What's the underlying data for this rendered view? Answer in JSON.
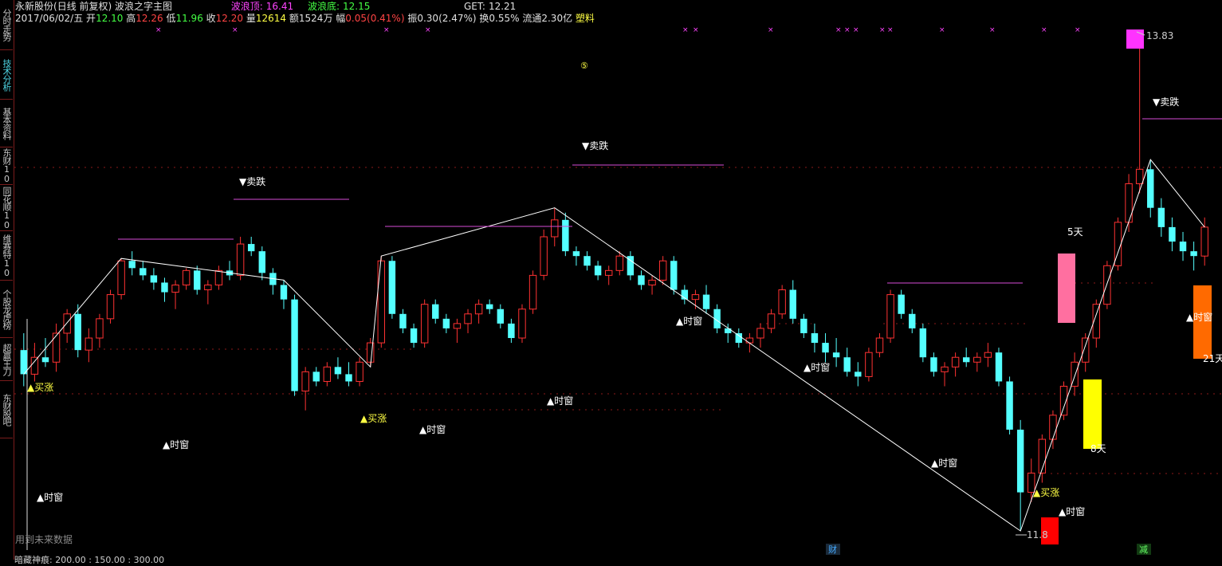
{
  "sidebar": {
    "tabs": [
      {
        "label": "分时走势",
        "active": false
      },
      {
        "label": "技术分析",
        "active": true
      },
      {
        "label": "基本资料",
        "active": false
      },
      {
        "label": "东财10",
        "active": false
      },
      {
        "label": "同花顺10",
        "active": false
      },
      {
        "label": "维赛特10",
        "active": false
      },
      {
        "label": "个股龙虎榜",
        "active": false
      },
      {
        "label": "超赢王刀",
        "active": false
      },
      {
        "label": "东财股吧",
        "active": false
      }
    ]
  },
  "header": {
    "stock_name": "永新股份",
    "period": "(日线 前复权)",
    "indicator_name": "波浪之字主图",
    "wave_top_label": "波浪顶:",
    "wave_top_value": "16.41",
    "wave_bottom_label": "波浪底:",
    "wave_bottom_value": "12.15",
    "get_label": "GET:",
    "get_value": "12.21",
    "date": "2017/06/02/五",
    "open_label": "开",
    "open": "12.10",
    "high_label": "高",
    "high": "12.26",
    "low_label": "低",
    "low": "11.96",
    "close_label": "收",
    "close": "12.20",
    "volume_label": "量",
    "volume": "12614",
    "amount_label": "额",
    "amount": "1524万",
    "change_label": "幅",
    "change": "0.05(0.41%)",
    "amplitude_label": "振",
    "amplitude": "0.30(2.47%)",
    "turnover_label": "换",
    "turnover": "0.55%",
    "float_cap_label": "流通",
    "float_cap": "2.30亿",
    "sector": "塑料"
  },
  "annotations": {
    "buy_label": "▲买涨",
    "sell_label": "▼卖跌",
    "time_window_label": "▲时窗",
    "max_price": "13.83",
    "min_price": "11.8",
    "days_5": "5天",
    "days_8": "8天",
    "days_21": "21天",
    "circle_mark": "⑤",
    "cai_mark": "财",
    "jian_mark": "减",
    "future_note": "用到未来数据"
  },
  "footer": {
    "text": "暗藏神痕: 200.00 : 150.00 : 300.00"
  },
  "colors": {
    "up": "#ff3232",
    "down": "#54ffff",
    "zigzag": "#ffffff",
    "level_line": "#d64bd6",
    "dotted": "#8b1a1a",
    "pink_box": "#ff6fa0",
    "yellow_box": "#ffff00",
    "orange_box": "#ff6a00",
    "magenta_box": "#ff33ff",
    "red_box": "#ff0000"
  },
  "chart_data": {
    "type": "candlestick",
    "title": "永新股份(日线 前复权) 波浪之字主图",
    "ylim": [
      11.8,
      13.83
    ],
    "max_price": 13.83,
    "min_price": 11.8,
    "candles_note": "approximate OHLC read from screenshot",
    "ohlc": [
      [
        12.55,
        12.62,
        12.4,
        12.45
      ],
      [
        12.45,
        12.58,
        12.42,
        12.52
      ],
      [
        12.52,
        12.6,
        12.48,
        12.5
      ],
      [
        12.5,
        12.66,
        12.46,
        12.62
      ],
      [
        12.62,
        12.72,
        12.58,
        12.7
      ],
      [
        12.7,
        12.74,
        12.52,
        12.55
      ],
      [
        12.55,
        12.64,
        12.5,
        12.6
      ],
      [
        12.6,
        12.7,
        12.56,
        12.68
      ],
      [
        12.68,
        12.8,
        12.66,
        12.78
      ],
      [
        12.78,
        12.93,
        12.76,
        12.92
      ],
      [
        12.92,
        12.96,
        12.86,
        12.89
      ],
      [
        12.89,
        12.92,
        12.84,
        12.86
      ],
      [
        12.86,
        12.89,
        12.8,
        12.83
      ],
      [
        12.83,
        12.85,
        12.75,
        12.79
      ],
      [
        12.79,
        12.84,
        12.72,
        12.82
      ],
      [
        12.82,
        12.89,
        12.8,
        12.88
      ],
      [
        12.88,
        12.9,
        12.78,
        12.8
      ],
      [
        12.8,
        12.84,
        12.74,
        12.82
      ],
      [
        12.82,
        12.9,
        12.8,
        12.88
      ],
      [
        12.88,
        12.92,
        12.84,
        12.86
      ],
      [
        12.86,
        13.02,
        12.84,
        12.99
      ],
      [
        12.99,
        13.02,
        12.94,
        12.96
      ],
      [
        12.96,
        12.98,
        12.84,
        12.87
      ],
      [
        12.87,
        12.89,
        12.78,
        12.82
      ],
      [
        12.82,
        12.84,
        12.72,
        12.76
      ],
      [
        12.76,
        12.78,
        12.36,
        12.38
      ],
      [
        12.38,
        12.48,
        12.3,
        12.46
      ],
      [
        12.46,
        12.48,
        12.4,
        12.42
      ],
      [
        12.42,
        12.5,
        12.4,
        12.48
      ],
      [
        12.48,
        12.52,
        12.43,
        12.45
      ],
      [
        12.45,
        12.5,
        12.4,
        12.42
      ],
      [
        12.42,
        12.52,
        12.4,
        12.5
      ],
      [
        12.5,
        12.6,
        12.48,
        12.58
      ],
      [
        12.58,
        12.94,
        12.56,
        12.92
      ],
      [
        12.92,
        12.94,
        12.68,
        12.7
      ],
      [
        12.7,
        12.72,
        12.62,
        12.64
      ],
      [
        12.64,
        12.66,
        12.56,
        12.58
      ],
      [
        12.58,
        12.76,
        12.56,
        12.74
      ],
      [
        12.74,
        12.76,
        12.66,
        12.68
      ],
      [
        12.68,
        12.7,
        12.62,
        12.64
      ],
      [
        12.64,
        12.68,
        12.58,
        12.66
      ],
      [
        12.66,
        12.72,
        12.62,
        12.7
      ],
      [
        12.7,
        12.76,
        12.66,
        12.74
      ],
      [
        12.74,
        12.76,
        12.7,
        12.72
      ],
      [
        12.72,
        12.74,
        12.64,
        12.66
      ],
      [
        12.66,
        12.68,
        12.58,
        12.6
      ],
      [
        12.6,
        12.74,
        12.58,
        12.72
      ],
      [
        12.72,
        12.88,
        12.7,
        12.86
      ],
      [
        12.86,
        13.05,
        12.84,
        13.02
      ],
      [
        13.02,
        13.14,
        12.98,
        13.09
      ],
      [
        13.09,
        13.12,
        12.94,
        12.96
      ],
      [
        12.96,
        12.98,
        12.9,
        12.94
      ],
      [
        12.94,
        12.96,
        12.88,
        12.9
      ],
      [
        12.9,
        12.92,
        12.84,
        12.86
      ],
      [
        12.86,
        12.9,
        12.82,
        12.88
      ],
      [
        12.88,
        12.96,
        12.86,
        12.94
      ],
      [
        12.94,
        12.96,
        12.84,
        12.86
      ],
      [
        12.86,
        12.88,
        12.8,
        12.82
      ],
      [
        12.82,
        12.86,
        12.78,
        12.84
      ],
      [
        12.84,
        12.94,
        12.82,
        12.92
      ],
      [
        12.92,
        12.94,
        12.78,
        12.8
      ],
      [
        12.8,
        12.82,
        12.74,
        12.76
      ],
      [
        12.76,
        12.8,
        12.72,
        12.78
      ],
      [
        12.78,
        12.82,
        12.7,
        12.72
      ],
      [
        12.72,
        12.74,
        12.62,
        12.64
      ],
      [
        12.64,
        12.66,
        12.58,
        12.62
      ],
      [
        12.62,
        12.64,
        12.56,
        12.58
      ],
      [
        12.58,
        12.62,
        12.54,
        12.6
      ],
      [
        12.6,
        12.66,
        12.56,
        12.64
      ],
      [
        12.64,
        12.72,
        12.62,
        12.7
      ],
      [
        12.7,
        12.82,
        12.68,
        12.8
      ],
      [
        12.8,
        12.84,
        12.66,
        12.68
      ],
      [
        12.68,
        12.7,
        12.6,
        12.62
      ],
      [
        12.62,
        12.66,
        12.54,
        12.58
      ],
      [
        12.58,
        12.62,
        12.5,
        12.54
      ],
      [
        12.54,
        12.6,
        12.48,
        12.52
      ],
      [
        12.52,
        12.56,
        12.44,
        12.46
      ],
      [
        12.46,
        12.5,
        12.4,
        12.44
      ],
      [
        12.44,
        12.56,
        12.42,
        12.54
      ],
      [
        12.54,
        12.62,
        12.52,
        12.6
      ],
      [
        12.6,
        12.8,
        12.58,
        12.78
      ],
      [
        12.78,
        12.8,
        12.68,
        12.7
      ],
      [
        12.7,
        12.72,
        12.62,
        12.64
      ],
      [
        12.64,
        12.66,
        12.5,
        12.52
      ],
      [
        12.52,
        12.54,
        12.44,
        12.46
      ],
      [
        12.46,
        12.5,
        12.4,
        12.48
      ],
      [
        12.48,
        12.54,
        12.44,
        12.52
      ],
      [
        12.52,
        12.56,
        12.48,
        12.5
      ],
      [
        12.5,
        12.54,
        12.46,
        12.52
      ],
      [
        12.52,
        12.58,
        12.48,
        12.54
      ],
      [
        12.54,
        12.56,
        12.4,
        12.42
      ],
      [
        12.42,
        12.44,
        12.2,
        12.22
      ],
      [
        12.22,
        12.26,
        11.8,
        11.96
      ],
      [
        11.96,
        12.1,
        11.92,
        12.04
      ],
      [
        12.04,
        12.2,
        12.0,
        12.18
      ],
      [
        12.18,
        12.3,
        12.14,
        12.28
      ],
      [
        12.28,
        12.42,
        12.26,
        12.4
      ],
      [
        12.4,
        12.54,
        12.36,
        12.5
      ],
      [
        12.5,
        12.62,
        12.46,
        12.6
      ],
      [
        12.6,
        12.76,
        12.56,
        12.74
      ],
      [
        12.74,
        12.92,
        12.72,
        12.9
      ],
      [
        12.9,
        13.1,
        12.88,
        13.08
      ],
      [
        13.08,
        13.28,
        13.04,
        13.24
      ],
      [
        13.24,
        13.83,
        13.2,
        13.3
      ],
      [
        13.3,
        13.34,
        13.1,
        13.14
      ],
      [
        13.14,
        13.18,
        13.02,
        13.06
      ],
      [
        13.06,
        13.1,
        12.96,
        13.0
      ],
      [
        13.0,
        13.04,
        12.92,
        12.96
      ],
      [
        12.96,
        13.0,
        12.88,
        12.94
      ],
      [
        12.94,
        13.1,
        12.9,
        13.06
      ]
    ]
  }
}
